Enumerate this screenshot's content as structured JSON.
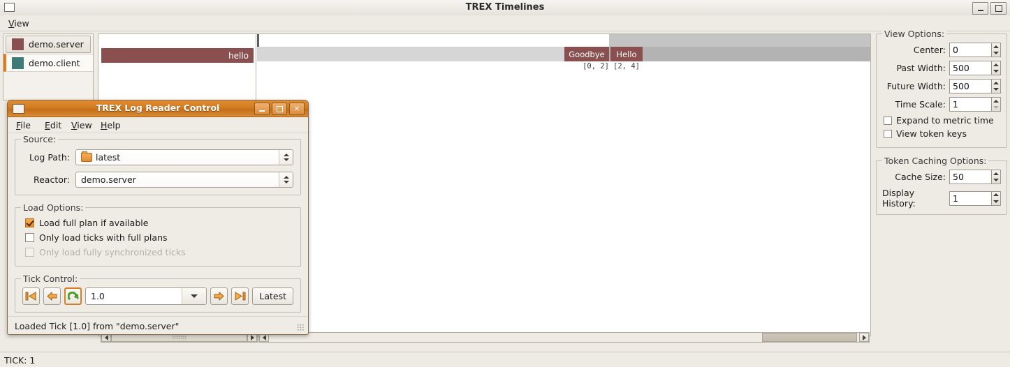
{
  "window": {
    "title": "TREX Timelines",
    "icon": "window-icon",
    "minimize": "minimize-icon",
    "maximize": "maximize-icon"
  },
  "menubar": {
    "items": [
      {
        "label": "View",
        "mnemonic": "V"
      }
    ]
  },
  "reactors": {
    "items": [
      {
        "label": "demo.server",
        "color": "#8a4f4f",
        "selected": true,
        "active": false
      },
      {
        "label": "demo.client",
        "color": "#3f7b78",
        "selected": false,
        "active": true
      }
    ]
  },
  "timeline": {
    "label_token": "hello",
    "tokens": [
      {
        "label": "Goodbye",
        "domain": "[0, 2]"
      },
      {
        "label": "Hello",
        "domain": "[2, 4]"
      }
    ],
    "token_color": "#8a4f4f",
    "past_color": "#d6d6d6",
    "future_color": "#b3b3b3"
  },
  "scrollbars": {
    "left_arrow": "scroll-left-icon",
    "right_arrow": "scroll-right-icon"
  },
  "view_options": {
    "legend": "View Options:",
    "fields": [
      {
        "label": "Center:",
        "value": "0"
      },
      {
        "label": "Past Width:",
        "value": "500"
      },
      {
        "label": "Future Width:",
        "value": "500"
      },
      {
        "label": "Time Scale:",
        "value": "1"
      }
    ],
    "checkboxes": [
      {
        "label": "Expand to metric time",
        "checked": false
      },
      {
        "label": "View token keys",
        "checked": false
      }
    ]
  },
  "token_caching": {
    "legend": "Token Caching Options:",
    "fields": [
      {
        "label": "Cache Size:",
        "value": "50"
      },
      {
        "label": "Display History:",
        "value": "1"
      }
    ]
  },
  "statusbar": {
    "text": "TICK: 1"
  },
  "dialog": {
    "title": "TREX Log Reader Control",
    "icon": "window-icon",
    "buttons": {
      "minimize": "minimize-icon",
      "maximize": "maximize-icon",
      "close": "close-icon",
      "close_glyph": "✕"
    },
    "menu": [
      {
        "label": "File",
        "mnemonic": "F"
      },
      {
        "label": "Edit",
        "mnemonic": "E"
      },
      {
        "label": "View",
        "mnemonic": "V"
      },
      {
        "label": "Help",
        "mnemonic": "H"
      }
    ],
    "source": {
      "legend": "Source:",
      "log_path": {
        "label": "Log Path:",
        "value": "latest",
        "icon": "folder-icon"
      },
      "reactor": {
        "label": "Reactor:",
        "value": "demo.server"
      }
    },
    "load_options": {
      "legend": "Load Options:",
      "items": [
        {
          "label": "Load full plan if available",
          "checked": true,
          "disabled": false
        },
        {
          "label": "Only load ticks with full plans",
          "checked": false,
          "disabled": false
        },
        {
          "label": "Only load fully synchronized ticks",
          "checked": false,
          "disabled": true
        }
      ]
    },
    "tick_control": {
      "legend": "Tick Control:",
      "buttons": [
        {
          "name": "first-tick-button",
          "icon": "skip-back-icon"
        },
        {
          "name": "previous-tick-button",
          "icon": "arrow-left-icon"
        },
        {
          "name": "reload-tick-button",
          "icon": "reload-icon"
        },
        {
          "name": "next-tick-button",
          "icon": "arrow-right-icon"
        },
        {
          "name": "last-tick-button",
          "icon": "skip-forward-icon"
        }
      ],
      "value": "1.0",
      "latest_label": "Latest"
    },
    "status": "Loaded Tick [1.0] from \"demo.server\""
  }
}
